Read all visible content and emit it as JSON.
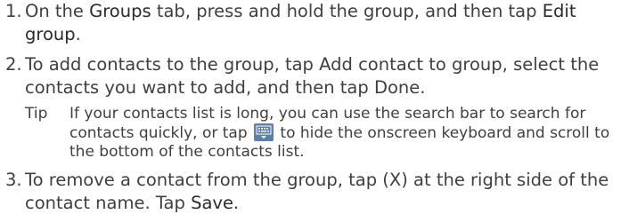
{
  "steps": [
    {
      "number": "1.",
      "parts": {
        "a": "On the ",
        "b": "Groups",
        "c": " tab, press and hold the group, and then tap ",
        "d": "Edit group",
        "e": "."
      }
    },
    {
      "number": "2.",
      "text": "To add contacts to the group, tap Add contact to group, select the contacts you want to add, and then tap Done."
    },
    {
      "number": "3.",
      "parts": {
        "a": "To remove a contact from the group, tap (X) at the right side of the contact name. Tap ",
        "b": "Save",
        "c": "."
      }
    }
  ],
  "tip": {
    "label": "Tip",
    "before_icon": "If your contacts list is long, you can use the search bar to search for contacts quickly, or tap ",
    "icon": "keyboard-icon",
    "after_icon": " to hide the onscreen keyboard and scroll to the bottom of the contacts list."
  }
}
